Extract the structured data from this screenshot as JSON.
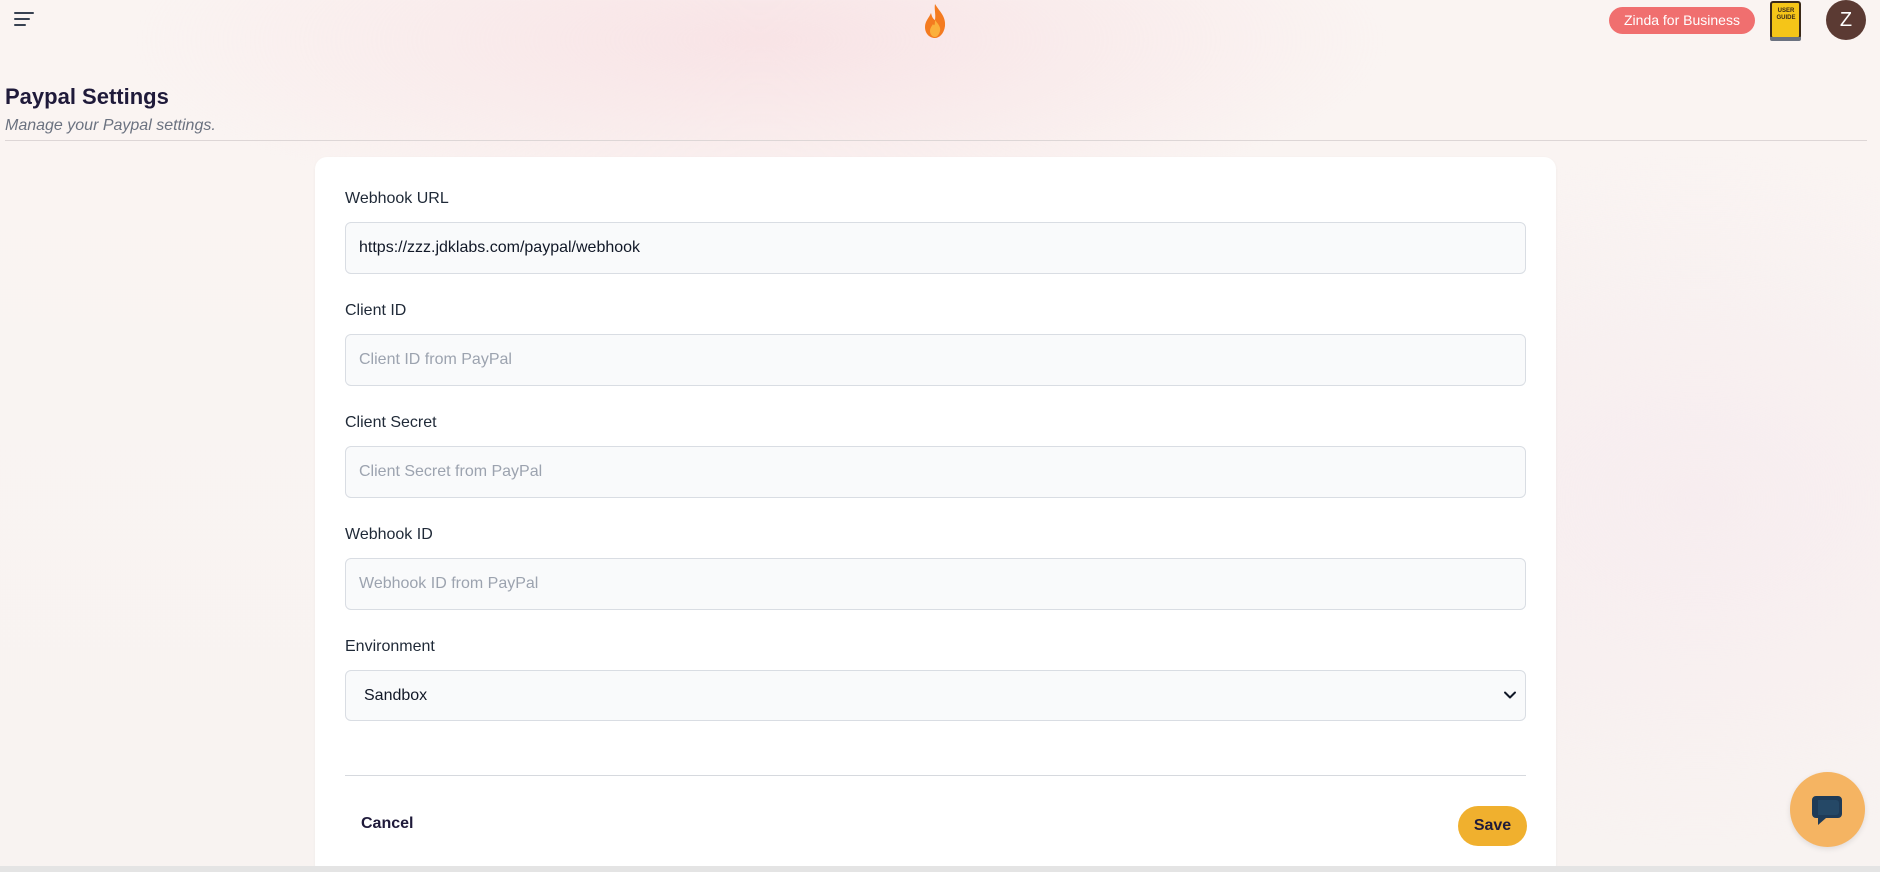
{
  "header": {
    "menu_icon": "hamburger-menu-icon",
    "logo_icon": "flame-icon",
    "business_button": "Zinda for Business",
    "user_guide_icon": "user-guide-book-icon",
    "user_guide_text": "USER GUIDE",
    "avatar_initial": "Z"
  },
  "page": {
    "title": "Paypal Settings",
    "subtitle": "Manage your Paypal settings."
  },
  "form": {
    "webhook_url": {
      "label": "Webhook URL",
      "value": "https://zzz.jdklabs.com/paypal/webhook",
      "placeholder": ""
    },
    "client_id": {
      "label": "Client ID",
      "value": "",
      "placeholder": "Client ID from PayPal"
    },
    "client_secret": {
      "label": "Client Secret",
      "value": "",
      "placeholder": "Client Secret from PayPal"
    },
    "webhook_id": {
      "label": "Webhook ID",
      "value": "",
      "placeholder": "Webhook ID from PayPal"
    },
    "environment": {
      "label": "Environment",
      "selected": "Sandbox"
    },
    "cancel_label": "Cancel",
    "save_label": "Save"
  },
  "chat_widget": {
    "icon": "chat-bubble-icon"
  },
  "colors": {
    "accent_save": "#f0b02e",
    "business_badge": "#f06f6f",
    "avatar_bg": "#5b3a33",
    "chat_bg": "#f5b462"
  }
}
